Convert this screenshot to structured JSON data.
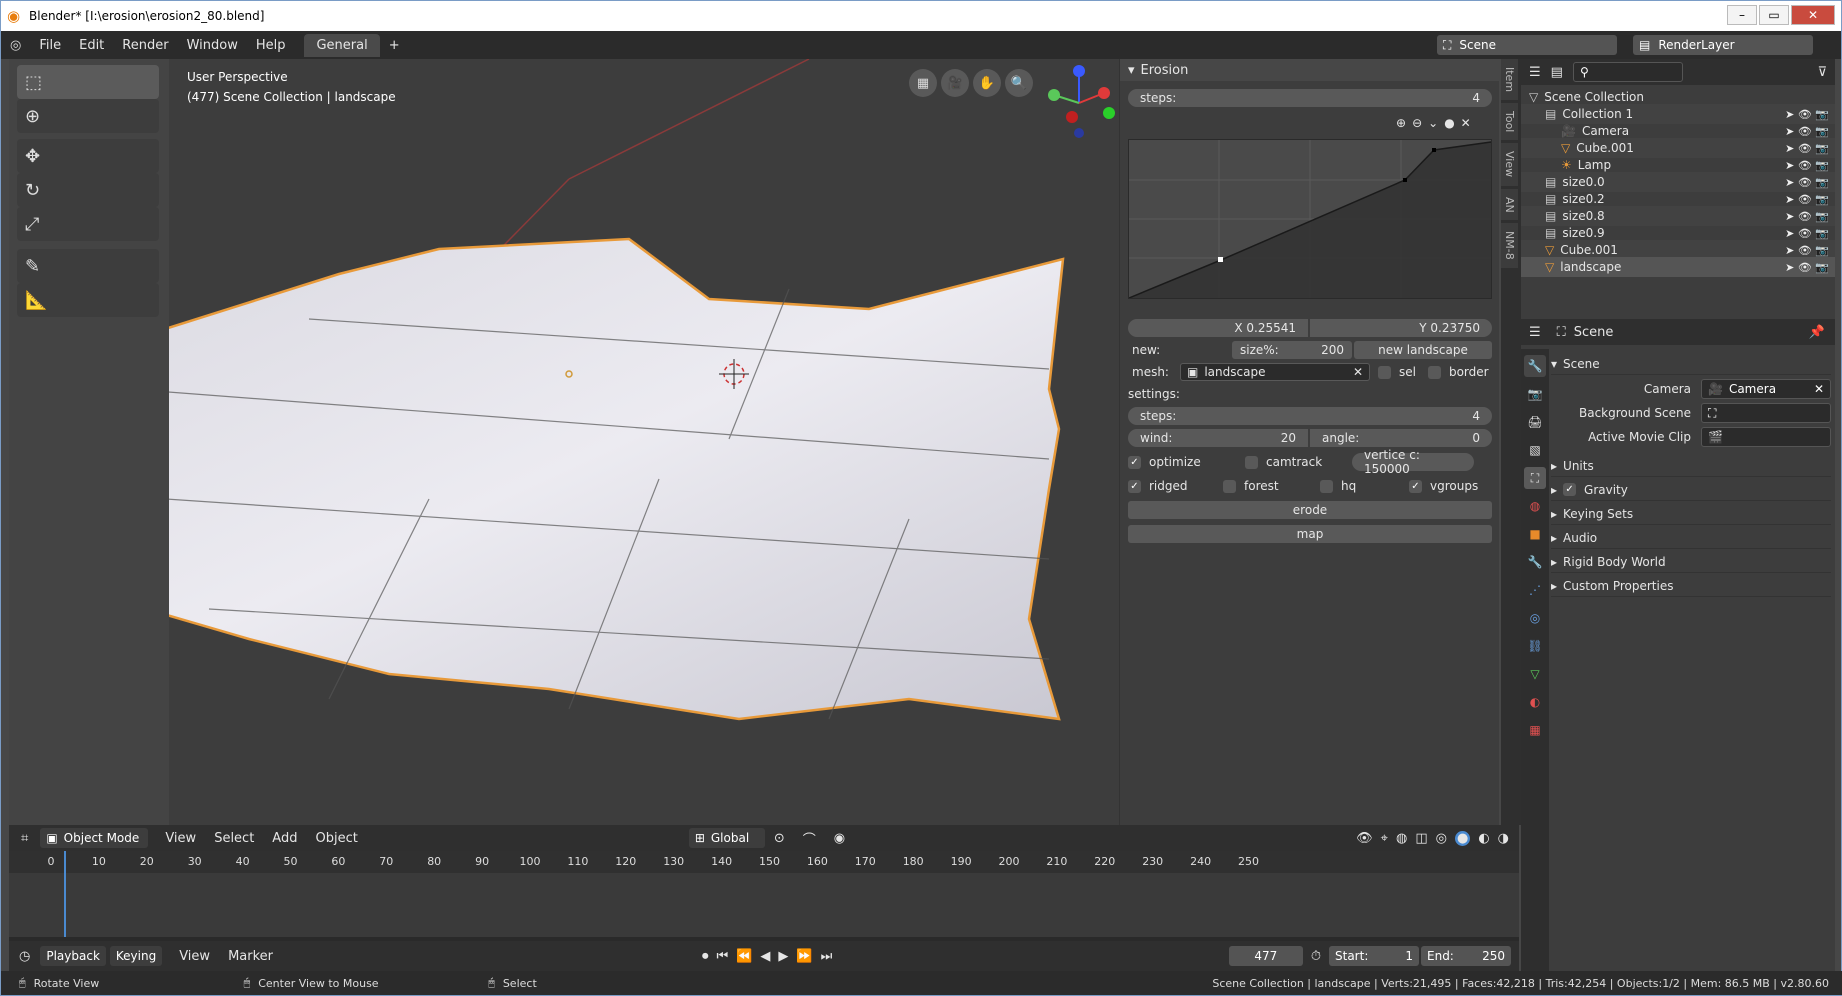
{
  "window": {
    "title": "Blender* [I:\\erosion\\erosion2_80.blend]"
  },
  "menu": [
    "File",
    "Edit",
    "Render",
    "Window",
    "Help"
  ],
  "workspace_tab": "General",
  "scene_field": "Scene",
  "renderlayer_field": "RenderLayer",
  "viewport": {
    "perspective": "User Perspective",
    "collection_info": "(477) Scene Collection | landscape"
  },
  "erosion": {
    "title": "Erosion",
    "steps_top": {
      "label": "steps:",
      "value": "4"
    },
    "curve": {
      "x_label": "X 0.25541",
      "y_label": "Y 0.23750"
    },
    "new_label": "new:",
    "size_label": "size%:",
    "size_value": "200",
    "new_landscape": "new landscape",
    "mesh_label": "mesh:",
    "mesh_value": "landscape",
    "sel": "sel",
    "border": "border",
    "settings": "settings:",
    "steps": {
      "label": "steps:",
      "value": "4"
    },
    "wind": {
      "label": "wind:",
      "value": "20"
    },
    "angle": {
      "label": "angle:",
      "value": "0"
    },
    "optimize": "optimize",
    "camtrack": "camtrack",
    "vertice": "vertice c: 150000",
    "ridged": "ridged",
    "forest": "forest",
    "hq": "hq",
    "vgroups": "vgroups",
    "erode": "erode",
    "map": "map"
  },
  "sidetabs": [
    "Item",
    "Tool",
    "View",
    "AN",
    "NM-8"
  ],
  "outliner": [
    {
      "name": "Scene Collection",
      "indent": 0
    },
    {
      "name": "Collection 1",
      "indent": 1
    },
    {
      "name": "Camera",
      "indent": 2
    },
    {
      "name": "Cube.001",
      "indent": 2
    },
    {
      "name": "Lamp",
      "indent": 2
    },
    {
      "name": "size0.0",
      "indent": 1
    },
    {
      "name": "size0.2",
      "indent": 1
    },
    {
      "name": "size0.8",
      "indent": 1
    },
    {
      "name": "size0.9",
      "indent": 1
    },
    {
      "name": "Cube.001",
      "indent": 1
    },
    {
      "name": "landscape",
      "indent": 1
    }
  ],
  "properties": {
    "context": "Scene",
    "section": "Scene",
    "camera_label": "Camera",
    "camera_value": "Camera",
    "bg_scene_label": "Background Scene",
    "movieclip_label": "Active Movie Clip",
    "subsections": [
      "Units",
      "Gravity",
      "Keying Sets",
      "Audio",
      "Rigid Body World",
      "Custom Properties"
    ]
  },
  "vp_header": {
    "mode": "Object Mode",
    "menus": [
      "View",
      "Select",
      "Add",
      "Object"
    ],
    "orientation": "Global"
  },
  "timeline": {
    "ticks": [
      "0",
      "10",
      "20",
      "30",
      "40",
      "50",
      "60",
      "70",
      "80",
      "90",
      "100",
      "110",
      "120",
      "130",
      "140",
      "150",
      "160",
      "170",
      "180",
      "190",
      "200",
      "210",
      "220",
      "230",
      "240",
      "250"
    ],
    "playback": "Playback",
    "keying": "Keying",
    "view": "View",
    "marker": "Marker",
    "current_frame": "477",
    "start_label": "Start:",
    "start": "1",
    "end_label": "End:",
    "end": "250"
  },
  "status": {
    "rotate": "Rotate View",
    "center": "Center View to Mouse",
    "select": "Select",
    "info": "Scene Collection | landscape | Verts:21,495 | Faces:42,218 | Tris:42,254 | Objects:1/2 | Mem: 86.5 MB | v2.80.60"
  }
}
